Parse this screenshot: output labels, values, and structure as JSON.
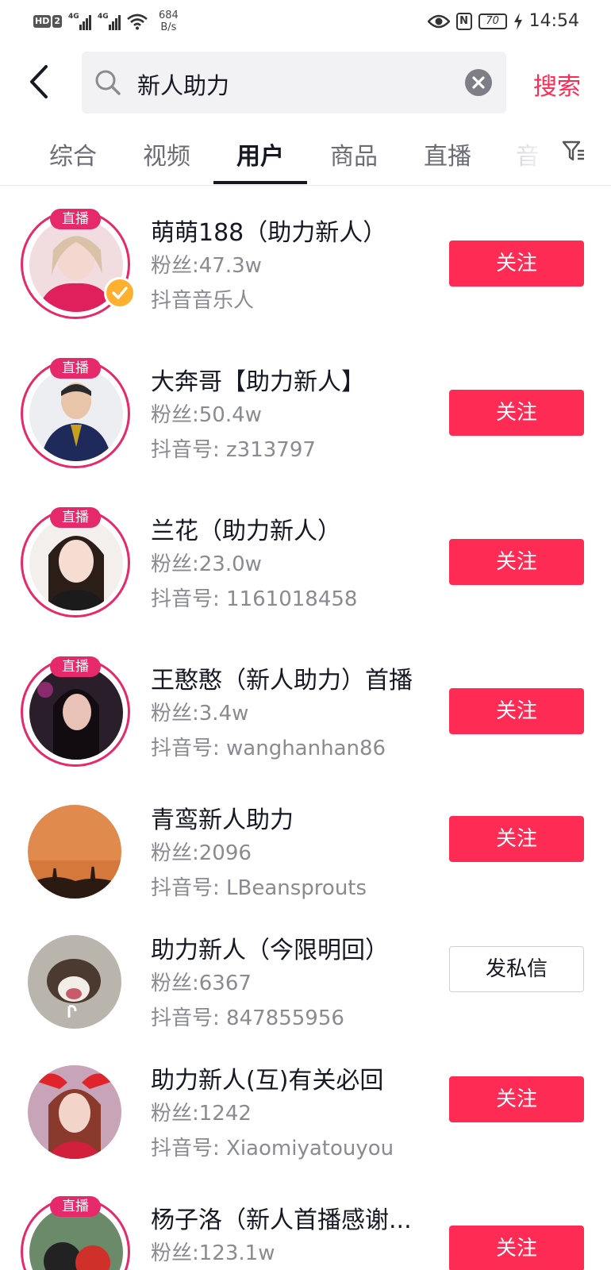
{
  "status_bar": {
    "hd_label": "HD",
    "sim_label": "2",
    "net1": "4G",
    "net2": "4G",
    "speed_value": "684",
    "speed_unit": "B/s",
    "nfc_label": "N",
    "battery": "70",
    "time": "14:54"
  },
  "search": {
    "query": "新人助力",
    "search_button": "搜索"
  },
  "tabs": [
    {
      "label": "综合",
      "active": false
    },
    {
      "label": "视频",
      "active": false
    },
    {
      "label": "用户",
      "active": true
    },
    {
      "label": "商品",
      "active": false
    },
    {
      "label": "直播",
      "active": false
    },
    {
      "label": "音",
      "active": false
    }
  ],
  "live_badge_label": "直播",
  "users": [
    {
      "name": "萌萌188（助力新人）",
      "fans": "粉丝:47.3w",
      "sub": "抖音音乐人",
      "live": true,
      "verified": true,
      "button": "关注",
      "button_style": "follow"
    },
    {
      "name": "大奔哥【助力新人】",
      "fans": "粉丝:50.4w",
      "sub": "抖音号: z313797",
      "live": true,
      "verified": false,
      "button": "关注",
      "button_style": "follow"
    },
    {
      "name": "兰花（助力新人）",
      "fans": "粉丝:23.0w",
      "sub": "抖音号: 1161018458",
      "live": true,
      "verified": false,
      "button": "关注",
      "button_style": "follow"
    },
    {
      "name": "王憨憨（新人助力）首播",
      "fans": "粉丝:3.4w",
      "sub": "抖音号: wanghanhan86",
      "live": true,
      "verified": false,
      "button": "关注",
      "button_style": "follow"
    },
    {
      "name": "青鸾新人助力",
      "fans": "粉丝:2096",
      "sub": "抖音号: LBeansprouts",
      "live": false,
      "verified": false,
      "button": "关注",
      "button_style": "follow"
    },
    {
      "name": "助力新人（今限明回）",
      "fans": "粉丝:6367",
      "sub": "抖音号: 847855956",
      "live": false,
      "verified": false,
      "button": "发私信",
      "button_style": "message"
    },
    {
      "name": "助力新人(互)有关必回",
      "fans": "粉丝:1242",
      "sub": "抖音号: Xiaomiyatouyou",
      "live": false,
      "verified": false,
      "button": "关注",
      "button_style": "follow"
    },
    {
      "name": "杨子洛（新人首播感谢...",
      "fans": "粉丝:123.1w",
      "sub": "",
      "live": true,
      "verified": false,
      "button": "关注",
      "button_style": "follow"
    }
  ],
  "colors": {
    "accent": "#fe2c55",
    "live_ring": "#e6296a",
    "verified": "#ffb02e"
  }
}
